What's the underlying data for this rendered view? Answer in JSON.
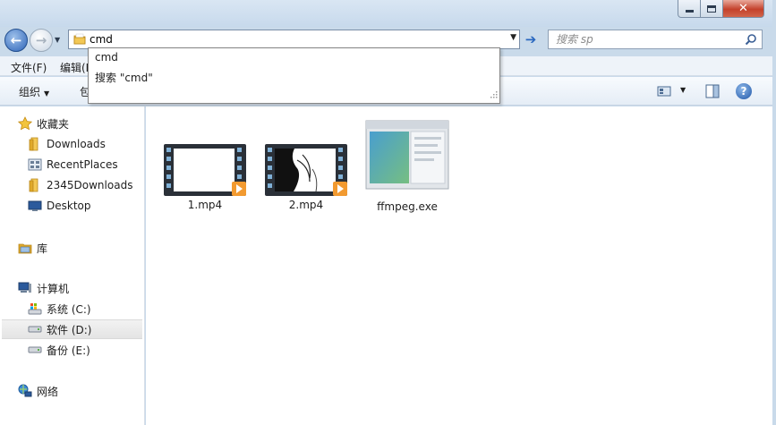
{
  "window": {
    "title": "",
    "controls": {
      "minimize": "minimize-icon",
      "maximize": "maximize-icon",
      "close": "close-icon"
    }
  },
  "address_bar": {
    "value": "cmd"
  },
  "search": {
    "placeholder": "搜索 sp"
  },
  "menu": {
    "file": "文件(F)",
    "edit": "编辑(E)"
  },
  "command_bar": {
    "organize": "组织",
    "include": "包"
  },
  "autocomplete": {
    "items": [
      "cmd",
      "搜索 \"cmd\""
    ]
  },
  "sidebar": {
    "favorites": {
      "label": "收藏夹",
      "items": [
        "Downloads",
        "RecentPlaces",
        "2345Downloads",
        "Desktop"
      ]
    },
    "libraries": {
      "label": "库"
    },
    "computer": {
      "label": "计算机",
      "drives": [
        "系统 (C:)",
        "软件 (D:)",
        "备份 (E:)"
      ],
      "selected": "软件 (D:)"
    },
    "network": {
      "label": "网络"
    }
  },
  "files": [
    {
      "name": "1.mp4",
      "type": "video"
    },
    {
      "name": "2.mp4",
      "type": "video"
    },
    {
      "name": "ffmpeg.exe",
      "type": "executable"
    }
  ],
  "colors": {
    "accent": "#2e64b8",
    "close": "#c4412b",
    "folder": "#e8b53a"
  }
}
